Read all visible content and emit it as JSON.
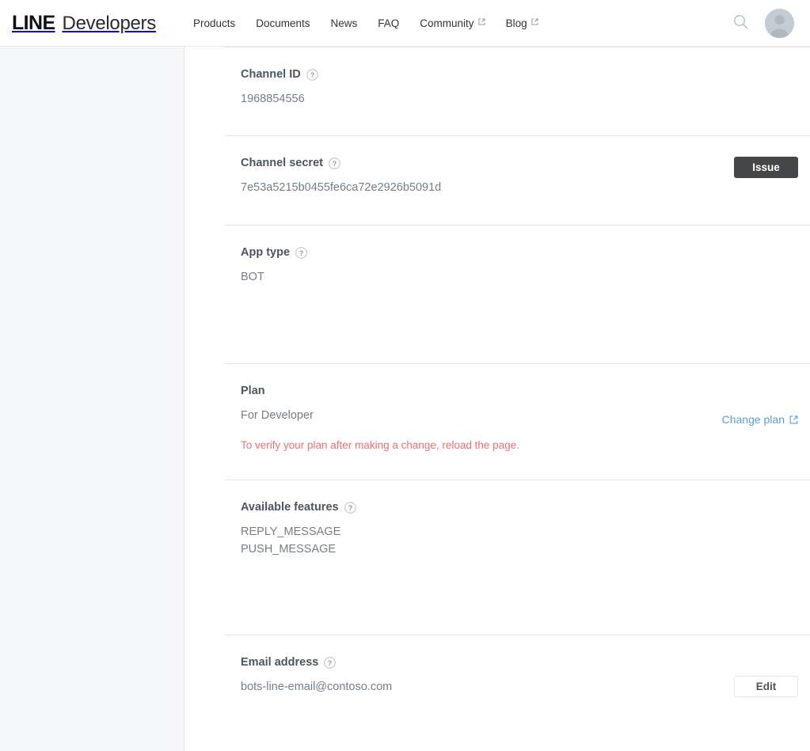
{
  "header": {
    "brand": {
      "line": "LINE",
      "developers": "Developers"
    },
    "nav": [
      {
        "label": "Products",
        "external": false
      },
      {
        "label": "Documents",
        "external": false
      },
      {
        "label": "News",
        "external": false
      },
      {
        "label": "FAQ",
        "external": false
      },
      {
        "label": "Community",
        "external": true
      },
      {
        "label": "Blog",
        "external": true
      }
    ],
    "search_icon": "search-icon",
    "avatar_icon": "user-avatar-placeholder"
  },
  "help_icon_label": "?",
  "sections": {
    "channel_id": {
      "label": "Channel ID",
      "value": "1968854556"
    },
    "channel_secret": {
      "label": "Channel secret",
      "value": "7e53a5215b0455fe6ca72e2926b5091d",
      "action_label": "Issue"
    },
    "app_type": {
      "label": "App type",
      "value": "BOT"
    },
    "plan": {
      "label": "Plan",
      "value": "For Developer",
      "link_label": "Change plan",
      "warning": "To verify your plan after making a change, reload the page."
    },
    "available_features": {
      "label": "Available features",
      "value": "REPLY_MESSAGE\nPUSH_MESSAGE"
    },
    "email_address": {
      "label": "Email address",
      "value": "bots-line-email@contoso.com",
      "action_label": "Edit"
    }
  },
  "colors": {
    "accent_link": "#58a0dd",
    "warning": "#f2706f",
    "button_dark": "#444648",
    "label": "#4c5560",
    "value": "#757e88"
  }
}
